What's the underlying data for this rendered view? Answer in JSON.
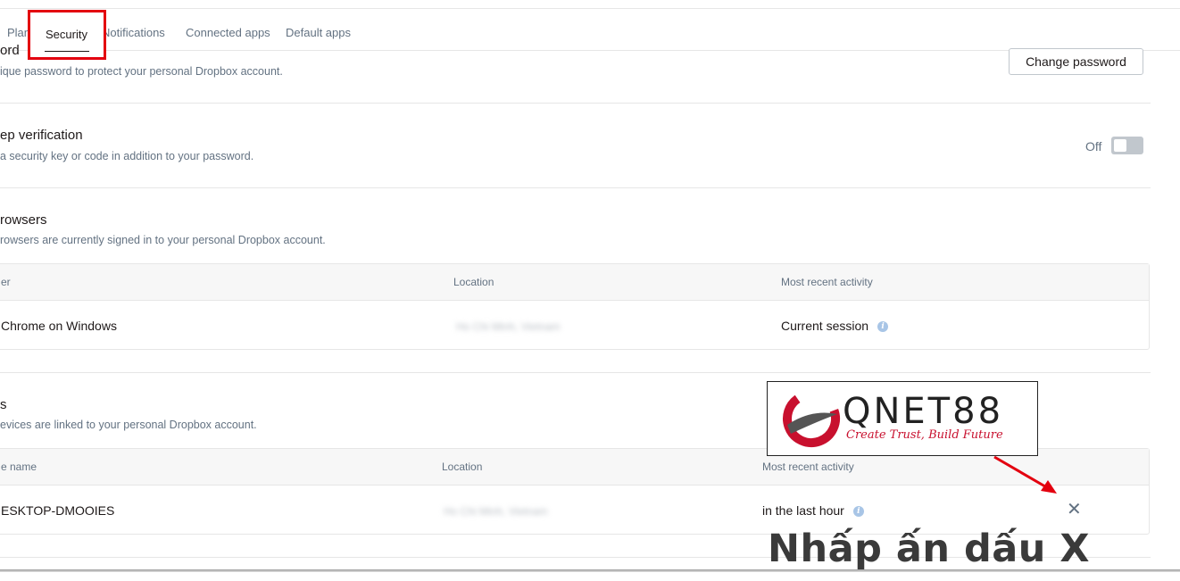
{
  "tabs": [
    {
      "label": "Plan"
    },
    {
      "label": "Security"
    },
    {
      "label": "Notifications"
    },
    {
      "label": "Connected apps"
    },
    {
      "label": "Default apps"
    }
  ],
  "password": {
    "title": "ord",
    "description": "ique password to protect your personal Dropbox account.",
    "button_label": "Change password"
  },
  "two_step": {
    "title": "ep verification",
    "description": "a security key or code in addition to your password.",
    "status_label": "Off",
    "enabled": false
  },
  "browsers": {
    "title": "rowsers",
    "description": "rowsers are currently signed in to your personal Dropbox account.",
    "columns": [
      "er",
      "Location",
      "Most recent activity"
    ],
    "rows": [
      {
        "name": "Chrome on Windows",
        "location": "Ho Chi Minh, Vietnam",
        "activity": "Current session"
      }
    ]
  },
  "devices": {
    "title": "s",
    "description": "evices are linked to your personal Dropbox account.",
    "columns": [
      "e name",
      "Location",
      "Most recent activity"
    ],
    "rows": [
      {
        "name": "ESKTOP-DMOOIES",
        "location": "Ho Chi Minh, Vietnam",
        "activity": "in the last hour"
      }
    ]
  },
  "watermark": {
    "brand": "QNET88",
    "tagline": "Create Trust, Build Future"
  },
  "annotation": {
    "text": "Nhấp ấn dấu X"
  },
  "colors": {
    "highlight": "#e3000f",
    "brand_red": "#c8102e",
    "text_primary": "#1e1919",
    "text_secondary": "#637282"
  },
  "icons": {
    "info": "info-icon",
    "close": "close-icon",
    "arrow": "arrow-icon"
  }
}
